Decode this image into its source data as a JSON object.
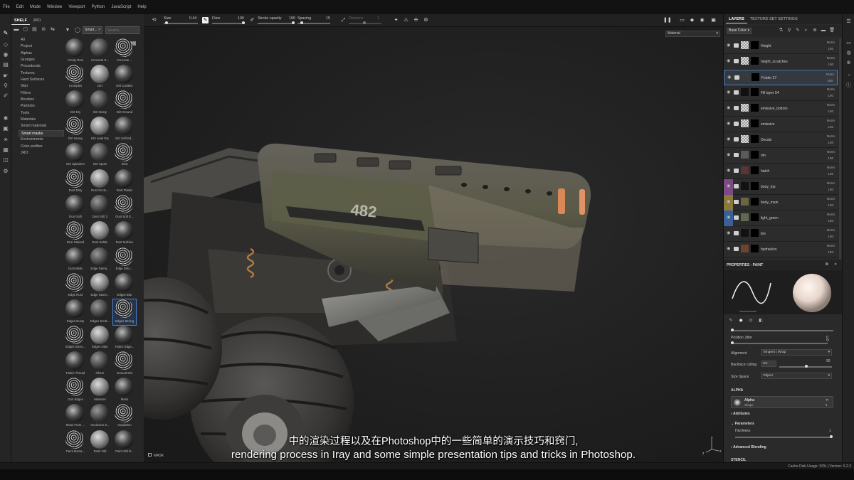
{
  "menubar": {
    "items": [
      "File",
      "Edit",
      "Mode",
      "Window",
      "Viewport",
      "Python",
      "JavaScript",
      "Help"
    ]
  },
  "shelf": {
    "tabs": [
      "SHELF",
      "JRO"
    ],
    "search_placeholder": "Search...",
    "filter_label": "Smart...",
    "categories": [
      "All",
      "Project",
      "Alphas",
      "Grunges",
      "Procedurals",
      "Textures",
      "Hard Surfaces",
      "Skin",
      "Filters",
      "Brushes",
      "Particles",
      "Tools",
      "Materials",
      "Smart materials",
      "Smart masks",
      "Environments",
      "Color profiles",
      "JRO"
    ],
    "active_category": "Smart masks",
    "items": [
      "Cavity Rust",
      "Concrete E...",
      "Concrete ...",
      "Crumples",
      "Dirt",
      "Dirt Cavities",
      "Dirt Dry",
      "Dirt Dusty",
      "Dirt Ground",
      "Dirt Heavy",
      "Dirt Leak Dry",
      "Dirt Soft Ed...",
      "Dirt Splashes",
      "Dirt Spots",
      "Dust",
      "Dust Dirty",
      "Dust Occlu...",
      "Dust Plastic",
      "Dust Soft",
      "Dust Soft 2",
      "Dust Soft E...",
      "Dust Stained",
      "Dust Subtle",
      "Dust Surface",
      "Dust Wide",
      "Edge Dama...",
      "Edge Dirty ...",
      "Edge Rust",
      "Edge Stone...",
      "Edges Blur",
      "Edges Dusty",
      "Edges Scrat...",
      "Edges Strong",
      "Edges Stron...",
      "Edges Uber",
      "Fabric Edge...",
      "Fabric Thread",
      "Fibers",
      "Ground Dirt",
      "Gun Edges",
      "Moisture",
      "Moss",
      "Moss From ...",
      "Occlusion S...",
      "Oxydation",
      "Paint Dama...",
      "Paint Old",
      "Paint Old D..."
    ],
    "selected_item": "Edges Strong"
  },
  "toolbar": {
    "size_label": "Size",
    "size_value": "0.44",
    "flow_label": "Flow",
    "flow_value": "100",
    "stroke_opacity_label": "Stroke opacity",
    "stroke_opacity_value": "100",
    "spacing_label": "Spacing",
    "spacing_value": "15",
    "distance_label": "Distance",
    "distance_value": "1"
  },
  "viewport": {
    "display_mode": "Material",
    "mask_label": "MASK",
    "decal_text": "482"
  },
  "subtitles": {
    "chinese": "中的渲染过程以及在Photoshop中的一些简单的演示技巧和窍门,",
    "english": "rendering process in Iray and some simple presentation tips and tricks in Photoshop."
  },
  "layers_panel": {
    "tabs": [
      "LAYERS",
      "TEXTURE SET SETTINGS"
    ],
    "channel": "Base Color",
    "layers": [
      {
        "name": "Height",
        "blend": "Norm",
        "opacity": "100",
        "thumb": "checker",
        "strip": ""
      },
      {
        "name": "height_scratches",
        "blend": "Norm",
        "opacity": "100",
        "thumb": "checker",
        "strip": ""
      },
      {
        "name": "Folder 27",
        "blend": "Norm",
        "opacity": "100",
        "thumb": "folder",
        "strip": "",
        "selected": true
      },
      {
        "name": "Fill layer 54",
        "blend": "Norm",
        "opacity": "100",
        "thumb": "dark",
        "strip": ""
      },
      {
        "name": "emissive_bottom",
        "blend": "Norm",
        "opacity": "100",
        "thumb": "checker",
        "strip": ""
      },
      {
        "name": "emissive",
        "blend": "Norm",
        "opacity": "100",
        "thumb": "checker",
        "strip": ""
      },
      {
        "name": "Decals",
        "blend": "Norm",
        "opacity": "100",
        "thumb": "checker",
        "strip": ""
      },
      {
        "name": "rim",
        "blend": "Norm",
        "opacity": "100",
        "thumb": "gray",
        "strip": ""
      },
      {
        "name": "hatch",
        "blend": "Norm",
        "opacity": "100",
        "thumb": "darkred",
        "strip": ""
      },
      {
        "name": "body_top",
        "blend": "Norm",
        "opacity": "100",
        "thumb": "dark",
        "strip": "#7d4a86"
      },
      {
        "name": "body_main",
        "blend": "Norm",
        "opacity": "100",
        "thumb": "olive",
        "strip": "#8a7a3a"
      },
      {
        "name": "light_green",
        "blend": "Norm",
        "opacity": "100",
        "thumb": "olive2",
        "strip": "#3a5f9a"
      },
      {
        "name": "tire",
        "blend": "Norm",
        "opacity": "100",
        "thumb": "dark",
        "strip": ""
      },
      {
        "name": "hydraulics",
        "blend": "Norm",
        "opacity": "100",
        "thumb": "brown",
        "strip": ""
      }
    ]
  },
  "properties": {
    "title": "PROPERTIES - PAINT",
    "position_jitter_label": "Position Jitter",
    "position_jitter_value": "0",
    "alignment_label": "Alignment",
    "alignment_value": "Tangent | Wrap",
    "backface_label": "Backface culling",
    "backface_value": "On",
    "backface_number": "90",
    "size_space_label": "Size Space",
    "size_space_value": "Object",
    "alpha_section": "ALPHA",
    "alpha_name": "Alpha",
    "alpha_sub": "Shape",
    "attributes_label": "Attributes",
    "parameters_label": "Parameters",
    "hardness_label": "Hardness",
    "hardness_value": "1",
    "advanced_label": "Advanced Blending",
    "stencil_label": "STENCIL"
  },
  "status": {
    "text": "Cache Disk Usage:   93% | Version: 6.2.2"
  },
  "colors": {
    "accent_blue": "#4b7ec9",
    "emissive_orange": "#e08a55",
    "body_olive": "#6d6a4c"
  }
}
